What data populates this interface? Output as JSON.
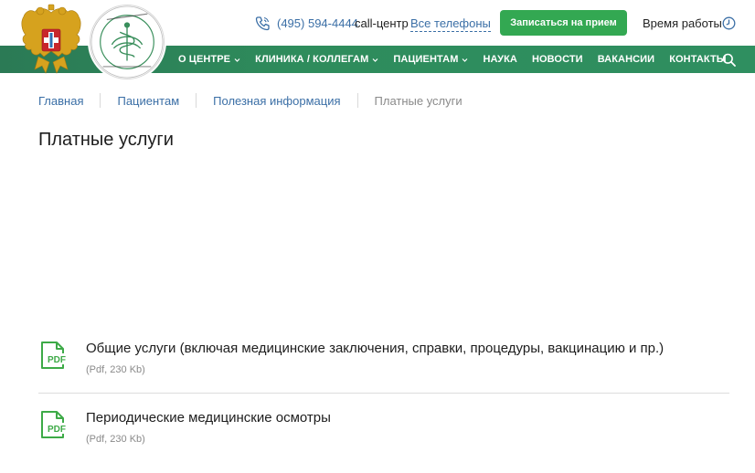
{
  "header": {
    "phone": "(495) 594-4444",
    "callcenter_label": "call-центр",
    "all_phones_link": "Все телефоны",
    "book_button": "Записаться на прием",
    "work_time_label": "Время работы",
    "colors": {
      "brand_green": "#2e8c5c",
      "button_green": "#33a852",
      "link_blue": "#3b6fa6"
    }
  },
  "nav": {
    "items": [
      {
        "label": "О ЦЕНТРЕ",
        "dropdown": true
      },
      {
        "label": "КЛИНИКА / КОЛЛЕГАМ",
        "dropdown": true
      },
      {
        "label": "ПАЦИЕНТАМ",
        "dropdown": true
      },
      {
        "label": "НАУКА",
        "dropdown": false
      },
      {
        "label": "НОВОСТИ",
        "dropdown": false
      },
      {
        "label": "ВАКАНСИИ",
        "dropdown": false
      },
      {
        "label": "КОНТАКТЫ",
        "dropdown": false
      }
    ]
  },
  "breadcrumb": [
    "Главная",
    "Пациентам",
    "Полезная информация",
    "Платные услуги"
  ],
  "page": {
    "title": "Платные услуги"
  },
  "documents": [
    {
      "title": "Общие услуги (включая медицинские заключения, справки, процедуры, вакцинацию и пр.)",
      "meta": "(Pdf, 230 Kb)",
      "icon": "pdf-icon",
      "icon_text": "PDF"
    },
    {
      "title": "Периодические медицинские осмотры",
      "meta": "(Pdf, 230 Kb)",
      "icon": "pdf-icon",
      "icon_text": "PDF"
    }
  ]
}
